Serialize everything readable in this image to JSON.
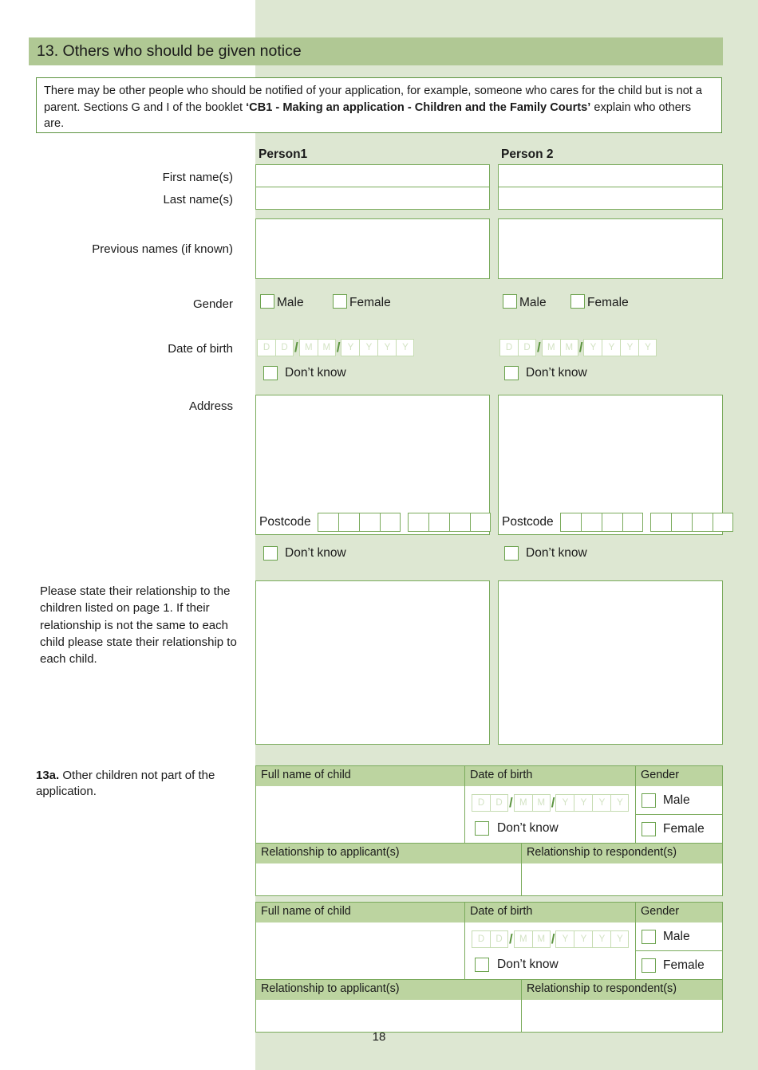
{
  "section": {
    "number": "13.",
    "title": "13. Others who should be given notice"
  },
  "intro": {
    "part1": "There may be other people who should be notified of your application, for example, someone who cares for the child but is not a parent. Sections G and I of the booklet ",
    "booklet": "‘CB1 - Making an application - Children and the Family Courts’",
    "part2": " explain who others are."
  },
  "columns": {
    "person1": "Person1",
    "person2": "Person 2"
  },
  "labels": {
    "first_name": "First name(s)",
    "last_name": "Last name(s)",
    "previous_names": "Previous names (if known)",
    "gender": "Gender",
    "date_of_birth": "Date of birth",
    "address": "Address",
    "relationship_note": "Please state their relationship to the children listed on page 1. If their relationship is not the same to each child please state their relationship to each child."
  },
  "options": {
    "male": "Male",
    "female": "Female",
    "dont_know": "Don’t know",
    "postcode": "Postcode"
  },
  "dob_placeholders": {
    "d1": "D",
    "d2": "D",
    "m1": "M",
    "m2": "M",
    "y1": "Y",
    "y2": "Y",
    "y3": "Y",
    "y4": "Y",
    "separator": "/"
  },
  "q13a": {
    "number": "13a.",
    "text": " Other children not part of the application."
  },
  "child_table": {
    "headers": {
      "full_name": "Full name of child",
      "date_of_birth": "Date of birth",
      "gender": "Gender",
      "rel_applicant": "Relationship to applicant(s)",
      "rel_respondent": "Relationship to respondent(s)"
    }
  },
  "footer": {
    "page_number": "18"
  },
  "colors": {
    "title_bar": "#b0c894",
    "panel_bg": "#dde7d2",
    "table_header": "#bcd4a0",
    "border_green": "#7aab5c",
    "checkbox_border": "#6aa24c",
    "placeholder_text": "#d3e3c4"
  }
}
